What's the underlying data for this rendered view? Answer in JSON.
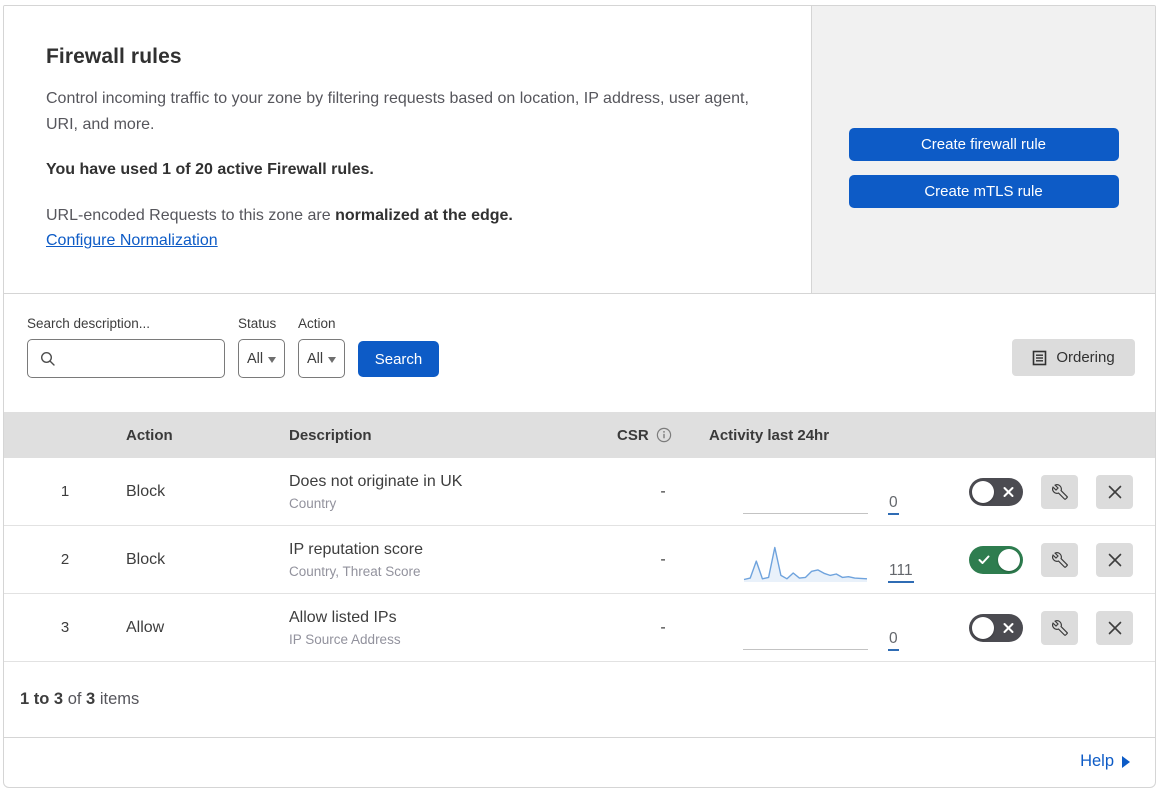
{
  "header": {
    "title": "Firewall rules",
    "description": "Control incoming traffic to your zone by filtering requests based on location, IP address, user agent, URI, and more.",
    "usage": "You have used 1 of 20 active Firewall rules.",
    "normalization_prefix": "URL-encoded Requests to this zone are ",
    "normalization_bold": "normalized at the edge.",
    "configure_link": "Configure Normalization",
    "create_firewall_button": "Create firewall rule",
    "create_mtls_button": "Create mTLS rule"
  },
  "filters": {
    "search_label": "Search description...",
    "search_value": "",
    "status_label": "Status",
    "status_value": "All",
    "action_label": "Action",
    "action_value": "All",
    "search_button": "Search",
    "ordering_button": "Ordering"
  },
  "table": {
    "headers": {
      "action": "Action",
      "description": "Description",
      "csr": "CSR",
      "activity": "Activity last 24hr"
    },
    "rows": [
      {
        "num": "1",
        "action": "Block",
        "description": "Does not originate in UK",
        "fields": "Country",
        "csr": "-",
        "activity_count": "0",
        "enabled": false,
        "has_sparkline": false
      },
      {
        "num": "2",
        "action": "Block",
        "description": "IP reputation score",
        "fields": "Country, Threat Score",
        "csr": "-",
        "activity_count": "111",
        "enabled": true,
        "has_sparkline": true
      },
      {
        "num": "3",
        "action": "Allow",
        "description": "Allow listed IPs",
        "fields": "IP Source Address",
        "csr": "-",
        "activity_count": "0",
        "enabled": false,
        "has_sparkline": false
      }
    ]
  },
  "sparkline": {
    "type": "line",
    "label": "Activity last 24hr (rule 2)",
    "total": 111,
    "values": [
      6,
      10,
      60,
      8,
      12,
      100,
      18,
      8,
      25,
      10,
      12,
      30,
      34,
      24,
      18,
      22,
      12,
      14,
      10,
      9,
      8
    ]
  },
  "footer": {
    "range": "1 to 3",
    "of": " of ",
    "total": "3",
    "items": " items",
    "help": "Help"
  },
  "colors": {
    "accent": "#0d5bc6",
    "link": "#0d5bc6",
    "toggle-green": "#2e7d4f",
    "toggle-gray": "#4b4b51",
    "panel-gray": "#f1f1f1",
    "thead-gray": "#dfdfdf",
    "btn-gray": "#dcdcdc",
    "border": "#d5d5d5",
    "spark-stroke": "#6fa3dd",
    "spark-fill": "#e9f1fa"
  }
}
